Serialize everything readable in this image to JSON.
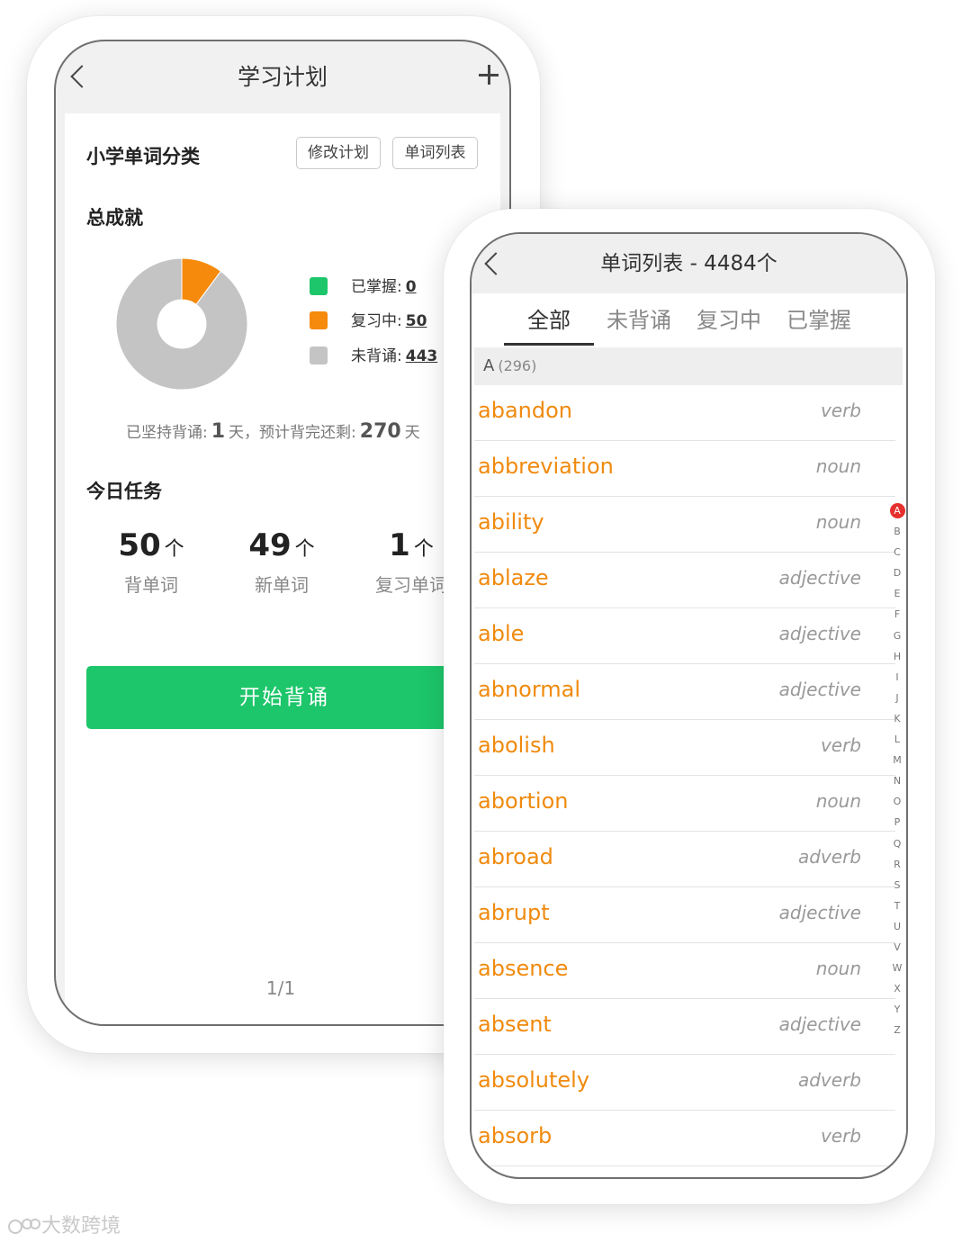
{
  "plan_screen": {
    "title": "学习计划",
    "category_title": "小学单词分类",
    "edit_plan_label": "修改计划",
    "word_list_label": "单词列表",
    "achievement_title": "总成就",
    "legend": [
      {
        "label": "已掌握:",
        "value": "0",
        "color": "#1dc66a"
      },
      {
        "label": "复习中:",
        "value": "50",
        "color": "#f58a0c"
      },
      {
        "label": "未背诵:",
        "value": "443",
        "color": "#c4c4c4"
      }
    ],
    "summary": {
      "prefix": "已坚持背诵:",
      "days": "1",
      "mid": "天，预计背完还剩:",
      "remain": "270",
      "suffix": "天"
    },
    "today_title": "今日任务",
    "tasks": [
      {
        "count": "50",
        "unit": "个",
        "label": "背单词"
      },
      {
        "count": "49",
        "unit": "个",
        "label": "新单词"
      },
      {
        "count": "1",
        "unit": "个",
        "label": "复习单词"
      }
    ],
    "start_label": "开始背诵",
    "pager": "1/1"
  },
  "list_screen": {
    "title": "单词列表 - 4484个",
    "tabs": [
      "全部",
      "未背诵",
      "复习中",
      "已掌握"
    ],
    "group": {
      "letter": "A",
      "count": "(296)"
    },
    "words": [
      {
        "word": "abandon",
        "pos": "verb"
      },
      {
        "word": "abbreviation",
        "pos": "noun"
      },
      {
        "word": "ability",
        "pos": "noun"
      },
      {
        "word": "ablaze",
        "pos": "adjective"
      },
      {
        "word": "able",
        "pos": "adjective"
      },
      {
        "word": "abnormal",
        "pos": "adjective"
      },
      {
        "word": "abolish",
        "pos": "verb"
      },
      {
        "word": "abortion",
        "pos": "noun"
      },
      {
        "word": "abroad",
        "pos": "adverb"
      },
      {
        "word": "abrupt",
        "pos": "adjective"
      },
      {
        "word": "absence",
        "pos": "noun"
      },
      {
        "word": "absent",
        "pos": "adjective"
      },
      {
        "word": "absolutely",
        "pos": "adverb"
      },
      {
        "word": "absorb",
        "pos": "verb"
      }
    ],
    "index_letters": [
      "A",
      "B",
      "C",
      "D",
      "E",
      "F",
      "G",
      "H",
      "I",
      "J",
      "K",
      "L",
      "M",
      "N",
      "O",
      "P",
      "Q",
      "R",
      "S",
      "T",
      "U",
      "V",
      "W",
      "X",
      "Y",
      "Z"
    ],
    "active_letter": "A",
    "word_color": "#f08a0e"
  },
  "watermark": "大数跨境"
}
